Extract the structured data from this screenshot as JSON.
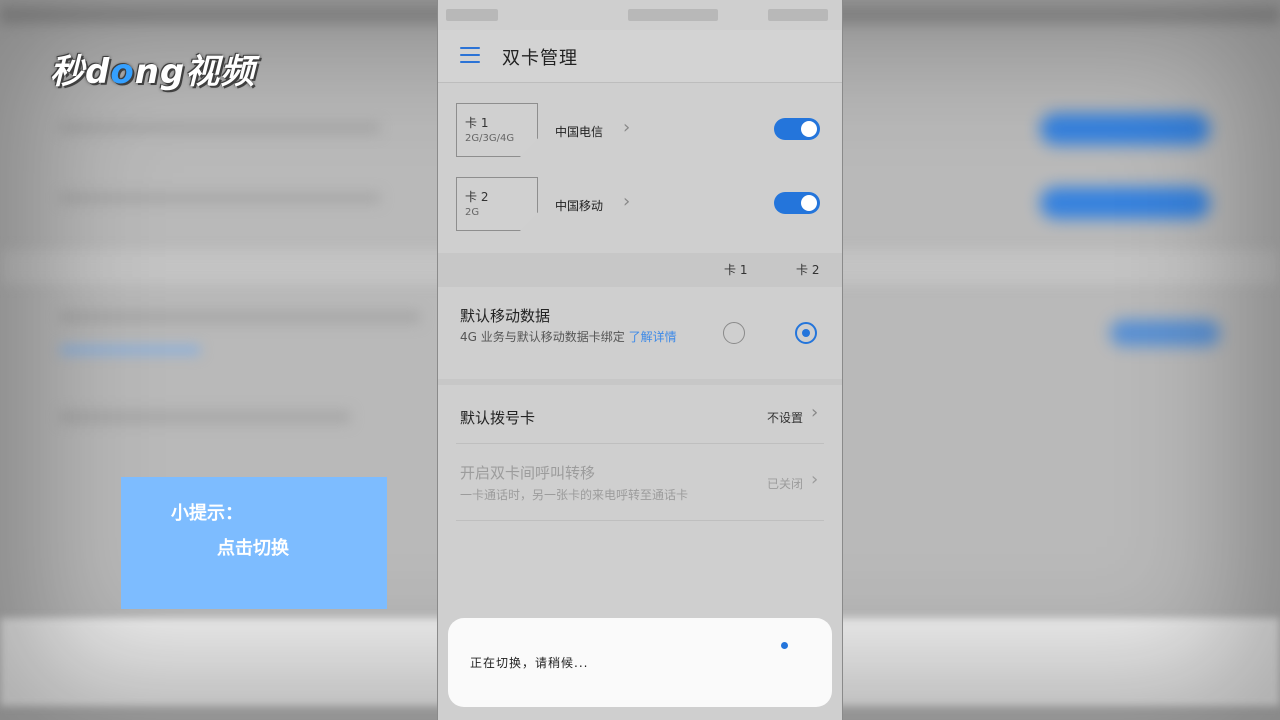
{
  "watermark": {
    "logo_pre": "秒",
    "logo_mid": "d",
    "logo_o": "o",
    "logo_post": "ng视频"
  },
  "tip": {
    "line1": "小提示：",
    "line2": "点击切换"
  },
  "appbar": {
    "title": "双卡管理"
  },
  "sims": [
    {
      "label": "卡 1",
      "network": "2G/3G/4G",
      "carrier": "中国电信",
      "enabled": true
    },
    {
      "label": "卡 2",
      "network": "2G",
      "carrier": "中国移动",
      "enabled": true
    }
  ],
  "columns": {
    "card1": "卡 1",
    "card2": "卡 2"
  },
  "default_data": {
    "title": "默认移动数据",
    "description": "4G  业务与默认移动数据卡绑定 ",
    "link": "了解详情",
    "selected": "card2"
  },
  "default_dial": {
    "title": "默认拨号卡",
    "value": "不设置"
  },
  "call_forward": {
    "title": "开启双卡间呼叫转移",
    "description": "一卡通话时，另一张卡的来电呼转至通话卡",
    "value": "已关闭"
  },
  "toast": {
    "message": "正在切换，请稍候..."
  },
  "colors": {
    "accent": "#2475db",
    "tip_bg": "#7dbcff"
  }
}
